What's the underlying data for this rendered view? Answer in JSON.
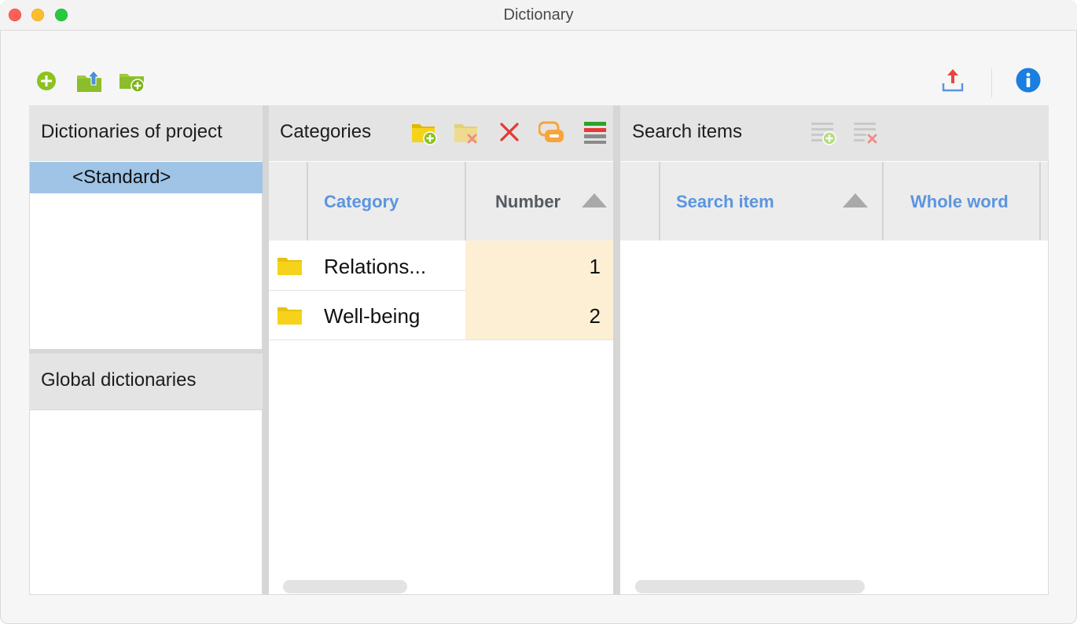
{
  "window": {
    "title": "Dictionary"
  },
  "toolbar": {
    "left_icons": [
      "add-icon",
      "import-folder-icon",
      "new-folder-icon"
    ],
    "right_icons": [
      "export-icon",
      "info-icon"
    ]
  },
  "dictionaries_pane": {
    "project_header": "Dictionaries of project",
    "project_items": [
      "<Standard>"
    ],
    "global_header": "Global dictionaries"
  },
  "categories_pane": {
    "header": "Categories",
    "tool_icons": [
      "add-category-icon",
      "delete-category-folder-icon",
      "delete-icon",
      "link-icon",
      "colors-icon"
    ],
    "columns": {
      "category": "Category",
      "number": "Number"
    },
    "rows": [
      {
        "category": "Relations...",
        "number": "1"
      },
      {
        "category": "Well-being",
        "number": "2"
      }
    ]
  },
  "search_pane": {
    "header": "Search items",
    "tool_icons": [
      "add-search-item-icon",
      "delete-search-item-icon"
    ],
    "columns": {
      "search_item": "Search item",
      "whole_word": "Whole word"
    }
  },
  "colors": {
    "selection": "#9fc4e6",
    "column_title": "#5b95e0",
    "number_cell": "#fdefd4",
    "folder": "#f6d31a"
  }
}
